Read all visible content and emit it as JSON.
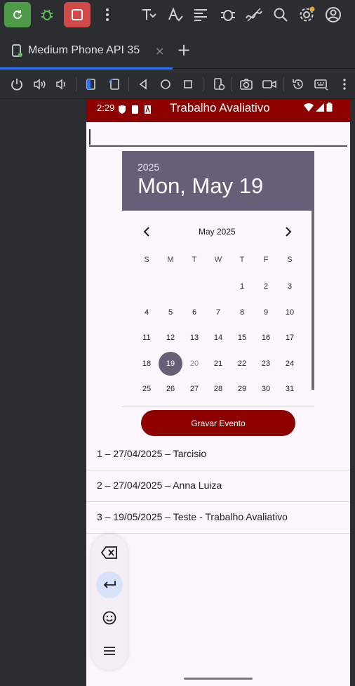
{
  "ide": {
    "tab_label": "Medium Phone API 35",
    "tab_close": "×",
    "tab_add": "+",
    "accent_color": "#3574f0"
  },
  "status_bar": {
    "time": "2:29",
    "title": "Trabalho Avaliativo",
    "color": "#8d0000"
  },
  "date_picker": {
    "year": "2025",
    "selected_date": "Mon, May 19",
    "month_label": "May 2025",
    "weekdays": [
      "S",
      "M",
      "T",
      "W",
      "T",
      "F",
      "S"
    ],
    "selected_day": "19",
    "header_color": "#675f77",
    "weeks": [
      [
        "",
        "",
        "",
        "",
        "1",
        "2",
        "3"
      ],
      [
        "4",
        "5",
        "6",
        "7",
        "8",
        "9",
        "10"
      ],
      [
        "11",
        "12",
        "13",
        "14",
        "15",
        "16",
        "17"
      ],
      [
        "18",
        "19",
        "20",
        "21",
        "22",
        "23",
        "24"
      ],
      [
        "25",
        "26",
        "27",
        "28",
        "29",
        "30",
        "31"
      ]
    ]
  },
  "save_button": {
    "label": "Gravar Evento"
  },
  "events": [
    {
      "text": "1 – 27/04/2025 – Tarcisio"
    },
    {
      "text": "2 – 27/04/2025 – Anna Luiza"
    },
    {
      "text": "3 – 19/05/2025 – Teste - Trabalho Avaliativo"
    }
  ]
}
